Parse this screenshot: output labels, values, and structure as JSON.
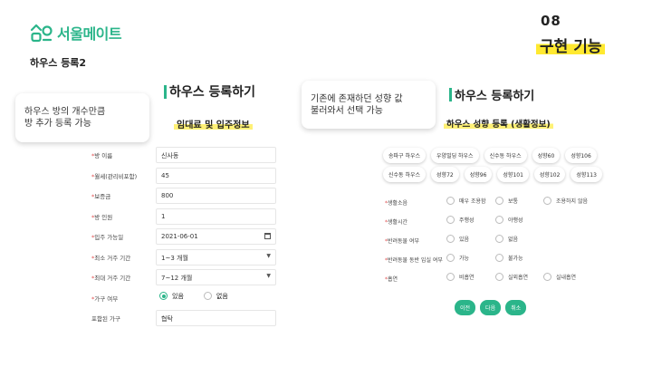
{
  "brand": {
    "name": "서울메이트",
    "color": "#2bb58a"
  },
  "page_subtitle": "하우스 등록2",
  "slide": {
    "number": "08",
    "title": "구현 기능"
  },
  "left": {
    "heading": "하우스 등록하기",
    "subheading": "임대료 및 입주정보",
    "note_lines": [
      "하우스 방의 개수만큼",
      "방 추가 등록 가능"
    ],
    "fields": [
      {
        "label": "방 이름",
        "required": true,
        "value": "신사동",
        "type": "text"
      },
      {
        "label": "월세(관리비포함)",
        "required": true,
        "value": "45",
        "type": "text"
      },
      {
        "label": "보증금",
        "required": true,
        "value": "800",
        "type": "text"
      },
      {
        "label": "방 인원",
        "required": true,
        "value": "1",
        "type": "text"
      },
      {
        "label": "입주 가능일",
        "required": true,
        "value": "2021-06-01",
        "type": "date"
      },
      {
        "label": "최소 거주 기간",
        "required": true,
        "value": "1~3 개월",
        "type": "select"
      },
      {
        "label": "최대 거주 기간",
        "required": true,
        "value": "7~12 개월",
        "type": "select"
      }
    ],
    "furniture": {
      "label": "가구 여부",
      "required": true,
      "options": [
        "있음",
        "없음"
      ],
      "selected": 0
    },
    "included": {
      "label": "포함된 가구",
      "value": "협탁"
    }
  },
  "right": {
    "heading": "하우스 등록하기",
    "subheading": "하우스 성향 등록 (생활정보)",
    "note_lines": [
      "기존에 존재하던 성향 값",
      "불러와서 선택 가능"
    ],
    "chips_row1": [
      "송파구 하우스",
      "우양빌딩 하우스",
      "신수동 하우스",
      "성향60",
      "성향106"
    ],
    "chips_row2": [
      "신수동 하우스",
      "성향72",
      "성향96",
      "성향101",
      "성향102",
      "성향113"
    ],
    "questions": [
      {
        "label": "생활소음",
        "options": [
          "매우 조용함",
          "보통",
          "조용하지 않음"
        ]
      },
      {
        "label": "생활시간",
        "options": [
          "주행성",
          "야행성"
        ]
      },
      {
        "label": "반려동물 여부",
        "options": [
          "있음",
          "없음"
        ]
      },
      {
        "label": "반려동물 동반 입실 여부",
        "options": [
          "가능",
          "불가능"
        ]
      },
      {
        "label": "흡연",
        "options": [
          "비흡연",
          "실외흡연",
          "실내흡연"
        ]
      }
    ],
    "buttons": [
      "이전",
      "다음",
      "취소"
    ]
  }
}
